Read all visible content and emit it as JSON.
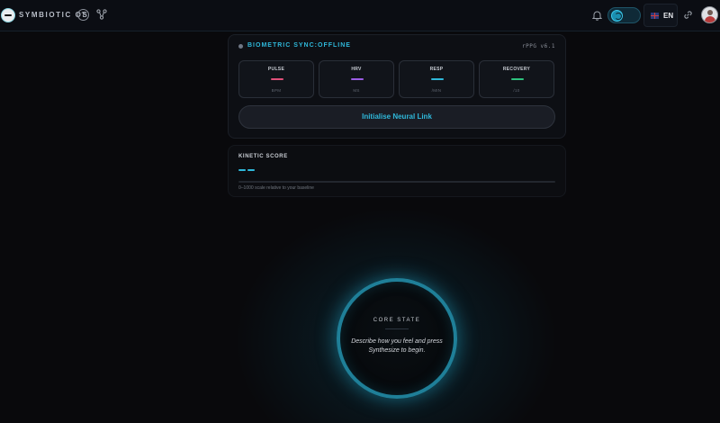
{
  "header": {
    "brand": "SYMBIOTIC OS",
    "help_symbol": "?",
    "language": "EN",
    "icons": [
      "logo-icon",
      "help-icon",
      "graph-icon",
      "bell-icon",
      "theme-toggle-icon",
      "flag-uk-icon",
      "link-icon",
      "avatar"
    ]
  },
  "biometric": {
    "title": "BIOMETRIC SYNC:OFFLINE",
    "version": "rPPG v6.1",
    "metrics": [
      {
        "label": "PULSE",
        "unit": "BPM",
        "color": "#e0507a"
      },
      {
        "label": "HRV",
        "unit": "MS",
        "color": "#9b5de5"
      },
      {
        "label": "RESP",
        "unit": "/MIN",
        "color": "#2fb8da"
      },
      {
        "label": "RECOVERY",
        "unit": "/10",
        "color": "#2ec27e"
      }
    ],
    "button_label": "Initialise Neural Link"
  },
  "kinetic": {
    "title": "KINETIC SCORE",
    "caption": "0–1000 scale relative to your baseline",
    "accent": "#2fb8da"
  },
  "core": {
    "title": "CORE STATE",
    "prompt": "Describe how you feel and press Synthesize to begin."
  }
}
